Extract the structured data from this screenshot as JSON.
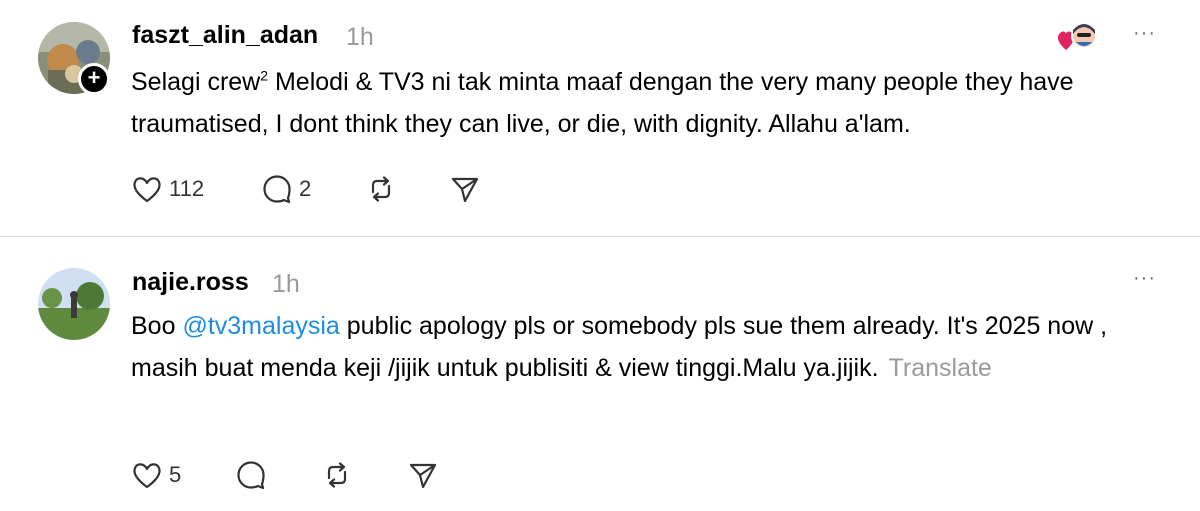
{
  "posts": [
    {
      "username": "faszt_alin_adan",
      "time": "1h",
      "text_before_sup": "Selagi crew",
      "sup": "2",
      "text_after_sup": " Melodi & TV3 ni tak minta maaf dengan the very many people they have traumatised, I dont think they can live, or die, with dignity. Allahu a'lam.",
      "likes": "112",
      "replies": "2",
      "more": "···",
      "follow_glyph": "+"
    },
    {
      "username": "najie.ross",
      "time": "1h",
      "text_before_mention": "Boo ",
      "mention": "@tv3malaysia",
      "text_after_mention": " public apology pls or somebody pls sue them already. It's 2025 now , masih buat menda keji /jijik untuk publisiti & view tinggi.Malu ya.jijik.",
      "translate": "Translate",
      "likes": "5",
      "more": "···"
    }
  ],
  "colors": {
    "mention": "#1f8ce0",
    "muted": "#9a9a9a",
    "divider": "#d9d9d9",
    "heart": "#e0245e"
  },
  "icons": [
    "heart-icon",
    "comment-icon",
    "repost-icon",
    "share-icon",
    "more-icon"
  ]
}
